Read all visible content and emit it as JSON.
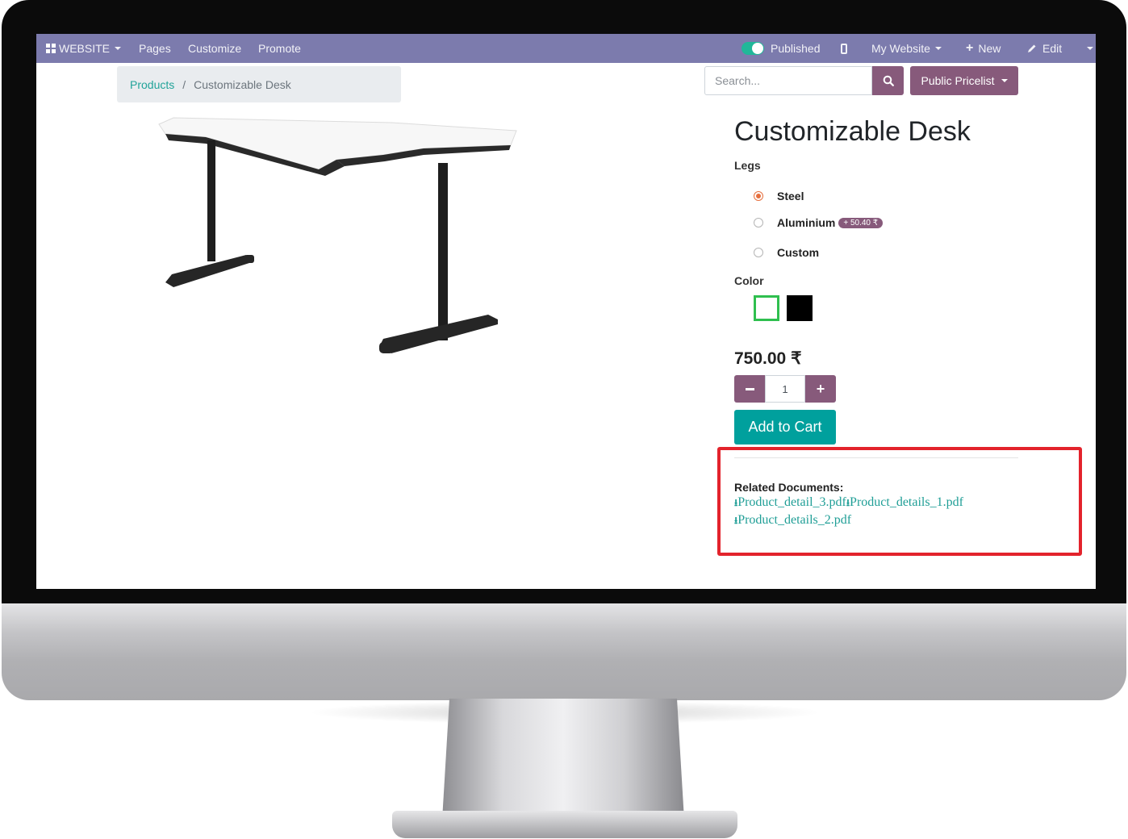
{
  "navbar": {
    "website_label": "WEBSITE",
    "pages": "Pages",
    "customize": "Customize",
    "promote": "Promote",
    "published": "Published",
    "my_website": "My Website",
    "new": "New",
    "edit": "Edit"
  },
  "breadcrumb": {
    "products": "Products",
    "separator": "/",
    "current": "Customizable Desk"
  },
  "search": {
    "placeholder": "Search..."
  },
  "pricelist": {
    "label": "Public Pricelist"
  },
  "product": {
    "title": "Customizable Desk",
    "legs_label": "Legs",
    "legs_options": [
      {
        "label": "Steel",
        "selected": true
      },
      {
        "label": "Aluminium",
        "extra": "+ 50.40 ₹",
        "selected": false
      },
      {
        "label": "Custom",
        "selected": false
      }
    ],
    "color_label": "Color",
    "colors": [
      {
        "name": "white",
        "hex": "#ffffff",
        "selected": true
      },
      {
        "name": "black",
        "hex": "#000000",
        "selected": false
      }
    ],
    "price": "750.00 ₹",
    "quantity": "1",
    "add_to_cart": "Add to Cart"
  },
  "related_documents": {
    "label": "Related Documents:",
    "files": [
      "Product_detail_3.pdf",
      "Product_details_1.pdf",
      "Product_details_2.pdf"
    ]
  },
  "colors": {
    "navbar": "#7c7bad",
    "primary": "#875a7b",
    "accent": "#00a09d",
    "highlight": "#e3232c"
  }
}
